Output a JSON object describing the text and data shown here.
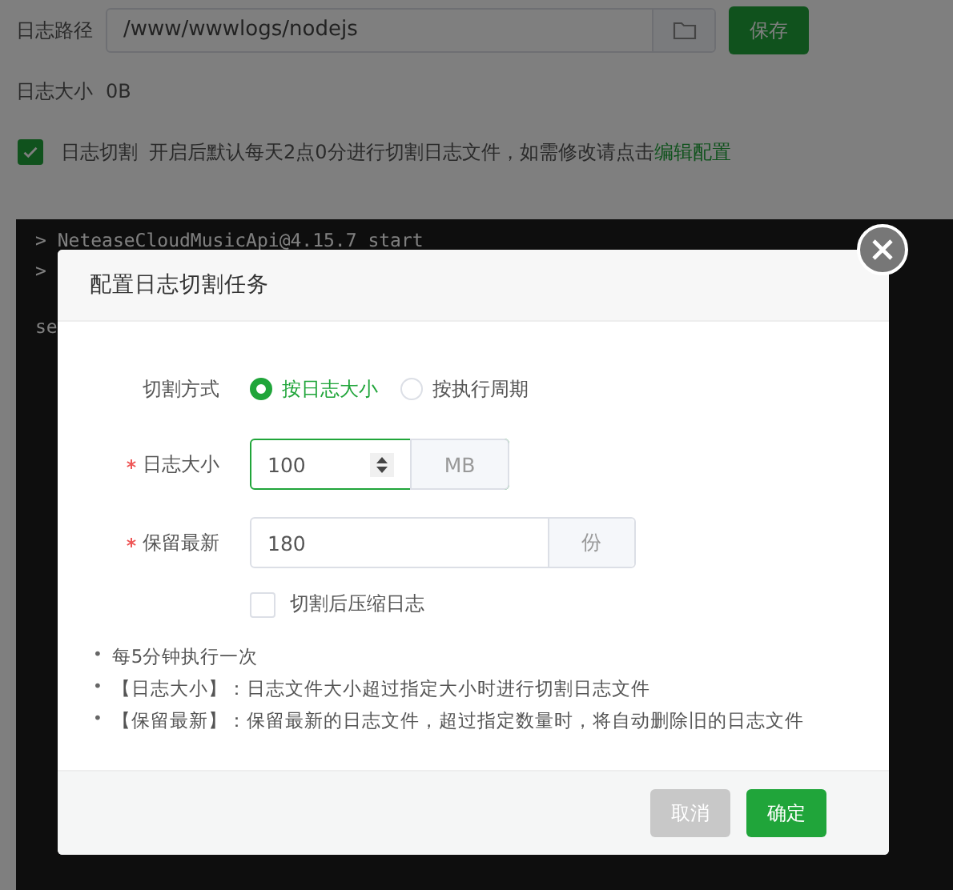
{
  "page": {
    "log_path": {
      "label": "日志路径",
      "value": "/www/wwwlogs/nodejs"
    },
    "save_button": "保存",
    "log_size": {
      "label": "日志大小",
      "value": "0B"
    },
    "log_rotation": {
      "checked": true,
      "label": "日志切割",
      "description": "开启后默认每天2点0分进行切割日志文件，如需修改请点击",
      "link": "编辑配置"
    },
    "terminal_lines": [
      "> NeteaseCloudMusicApi@4.15.7 start",
      ">",
      "se"
    ]
  },
  "dialog": {
    "title": "配置日志切割任务",
    "mode": {
      "label": "切割方式",
      "options": [
        {
          "label": "按日志大小",
          "selected": true
        },
        {
          "label": "按执行周期",
          "selected": false
        }
      ]
    },
    "fields": [
      {
        "label": "日志大小",
        "required": true,
        "value": "100",
        "unit": "MB",
        "kind": "spinner",
        "focused": true
      },
      {
        "label": "保留最新",
        "required": true,
        "value": "180",
        "unit": "份",
        "kind": "text",
        "focused": false
      }
    ],
    "compress": {
      "label": "切割后压缩日志",
      "checked": false
    },
    "notes": [
      {
        "bullet": "•",
        "text": "每5分钟执行一次"
      },
      {
        "bullet": "•",
        "text": "【日志大小】：日志文件大小超过指定大小时进行切割日志文件"
      },
      {
        "bullet": "•",
        "text": "【保留最新】：保留最新的日志文件，超过指定数量时，将自动删除旧的日志文件"
      }
    ],
    "buttons": [
      {
        "label": "取消",
        "kind": "cancel"
      },
      {
        "label": "确定",
        "kind": "primary"
      }
    ]
  }
}
